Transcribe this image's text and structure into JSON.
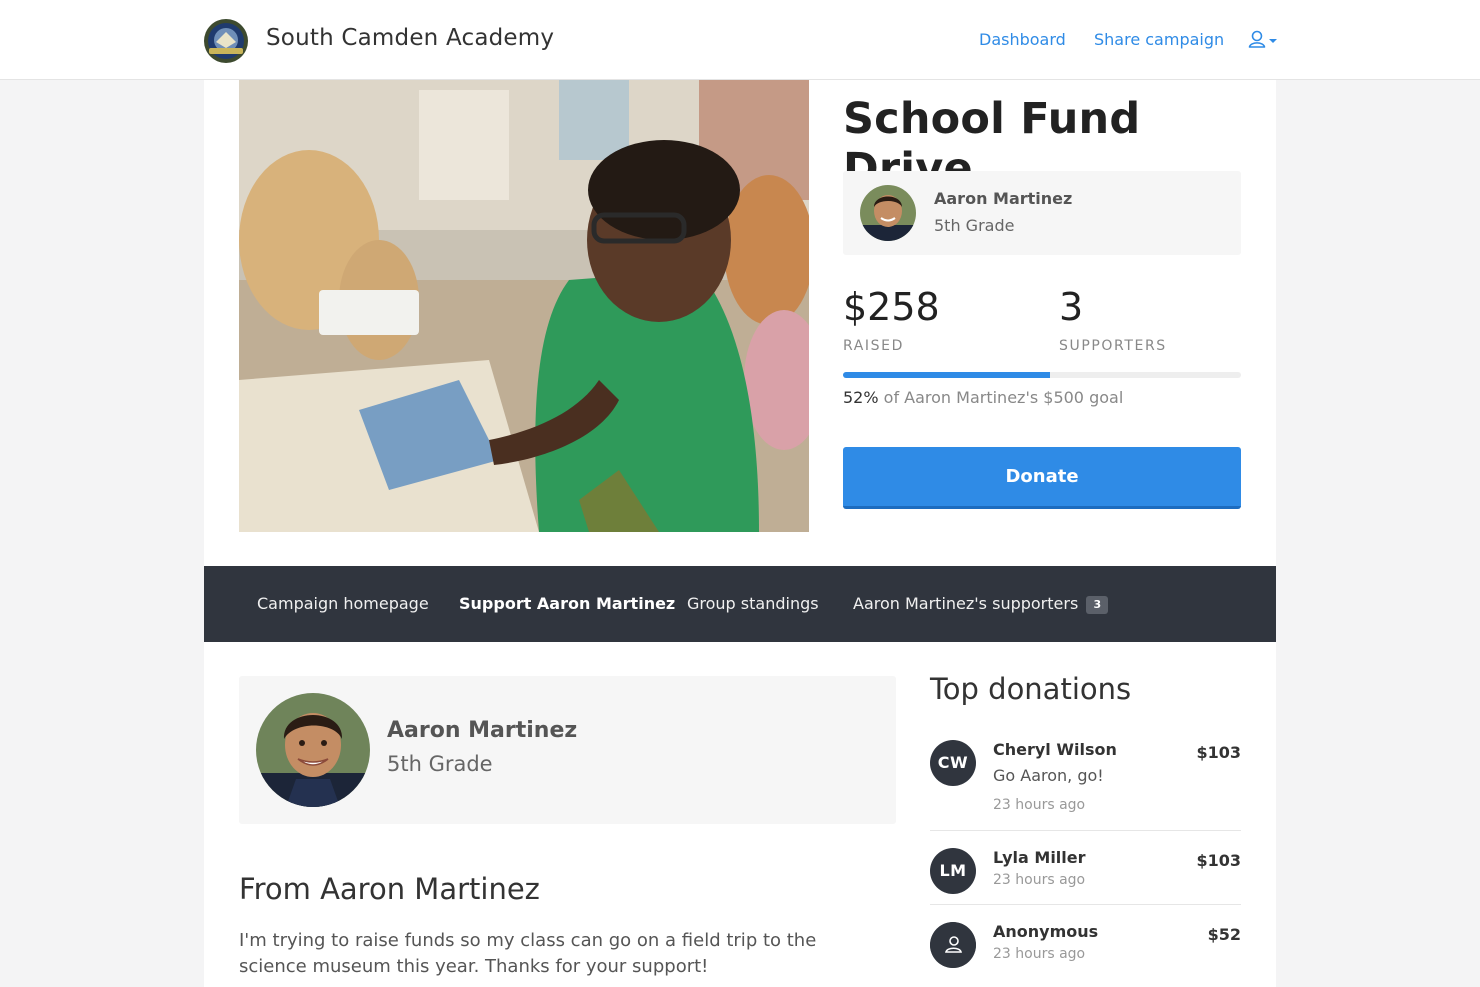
{
  "header": {
    "org_name": "South Camden Academy",
    "nav": {
      "dashboard": "Dashboard",
      "share": "Share campaign"
    }
  },
  "campaign": {
    "title": "School Fund Drive",
    "student_name": "Aaron Martinez",
    "student_grade": "5th Grade",
    "raised": "$258",
    "raised_label": "RAISED",
    "supporters": "3",
    "supporters_label": "SUPPORTERS",
    "progress_percent": 52,
    "goal_pct_text": "52%",
    "goal_text": " of Aaron Martinez's $500 goal",
    "donate_label": "Donate"
  },
  "tabs": [
    {
      "label": "Campaign homepage"
    },
    {
      "label": "Support Aaron Martinez"
    },
    {
      "label": "Group standings"
    },
    {
      "label": "Aaron Martinez's supporters",
      "badge": "3"
    }
  ],
  "profile": {
    "name": "Aaron Martinez",
    "grade": "5th Grade",
    "from_title": "From Aaron Martinez",
    "message": "I'm trying to raise funds so my class can go on a field trip to the science museum this year. Thanks for your support!"
  },
  "top_donations": {
    "title": "Top donations",
    "items": [
      {
        "initials": "CW",
        "name": "Cheryl Wilson",
        "message": "Go Aaron, go!",
        "time": "23 hours ago",
        "amount": "$103"
      },
      {
        "initials": "LM",
        "name": "Lyla Miller",
        "time": "23 hours ago",
        "amount": "$103"
      },
      {
        "icon": "anonymous-user-icon",
        "name": "Anonymous",
        "time": "23 hours ago",
        "amount": "$52"
      }
    ]
  },
  "colors": {
    "accent": "#2f8be6",
    "dark_bar": "#30353e"
  }
}
